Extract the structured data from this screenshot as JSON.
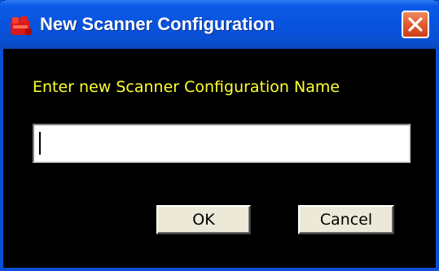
{
  "window": {
    "title": "New Scanner Configuration",
    "app_icon": "red-scanner-app-icon",
    "close_icon": "close-x-icon"
  },
  "dialog": {
    "prompt": "Enter new Scanner Configuration Name",
    "name_input": {
      "value": "",
      "placeholder": ""
    },
    "ok_label": "OK",
    "cancel_label": "Cancel"
  },
  "colors": {
    "dialog_background": "#000000",
    "prompt_text": "#ffff33",
    "titlebar": "#0752dd",
    "close_button": "#e25a2e",
    "button_face": "#ece9d8"
  }
}
